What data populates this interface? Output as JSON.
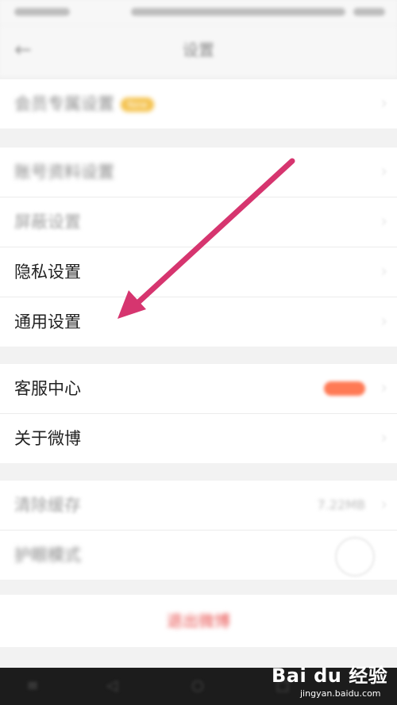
{
  "header": {
    "title": "设置",
    "back_glyph": "←"
  },
  "groups": [
    {
      "items": [
        {
          "label": "会员专属设置",
          "badge": "New"
        }
      ]
    },
    {
      "items": [
        {
          "label": "账号资料设置"
        },
        {
          "label": "屏蔽设置"
        },
        {
          "label": "隐私设置"
        },
        {
          "label": "通用设置"
        }
      ]
    },
    {
      "items": [
        {
          "label": "客服中心"
        },
        {
          "label": "关于微博"
        }
      ]
    },
    {
      "items": [
        {
          "label": "清除缓存",
          "value": "7.22MB"
        },
        {
          "label": "护眼模式"
        }
      ]
    }
  ],
  "logout": {
    "label": "退出微博"
  },
  "watermark": {
    "logo": "Bai du 经验",
    "url": "jingyan.baidu.com"
  },
  "colors": {
    "annotation_arrow": "#d6356f",
    "logout_text": "#e8504e",
    "badge": "#f4c14a",
    "pill": "#ff7a55"
  },
  "icons": {
    "back": "back-arrow-icon",
    "chevron": "chevron-right-icon"
  }
}
